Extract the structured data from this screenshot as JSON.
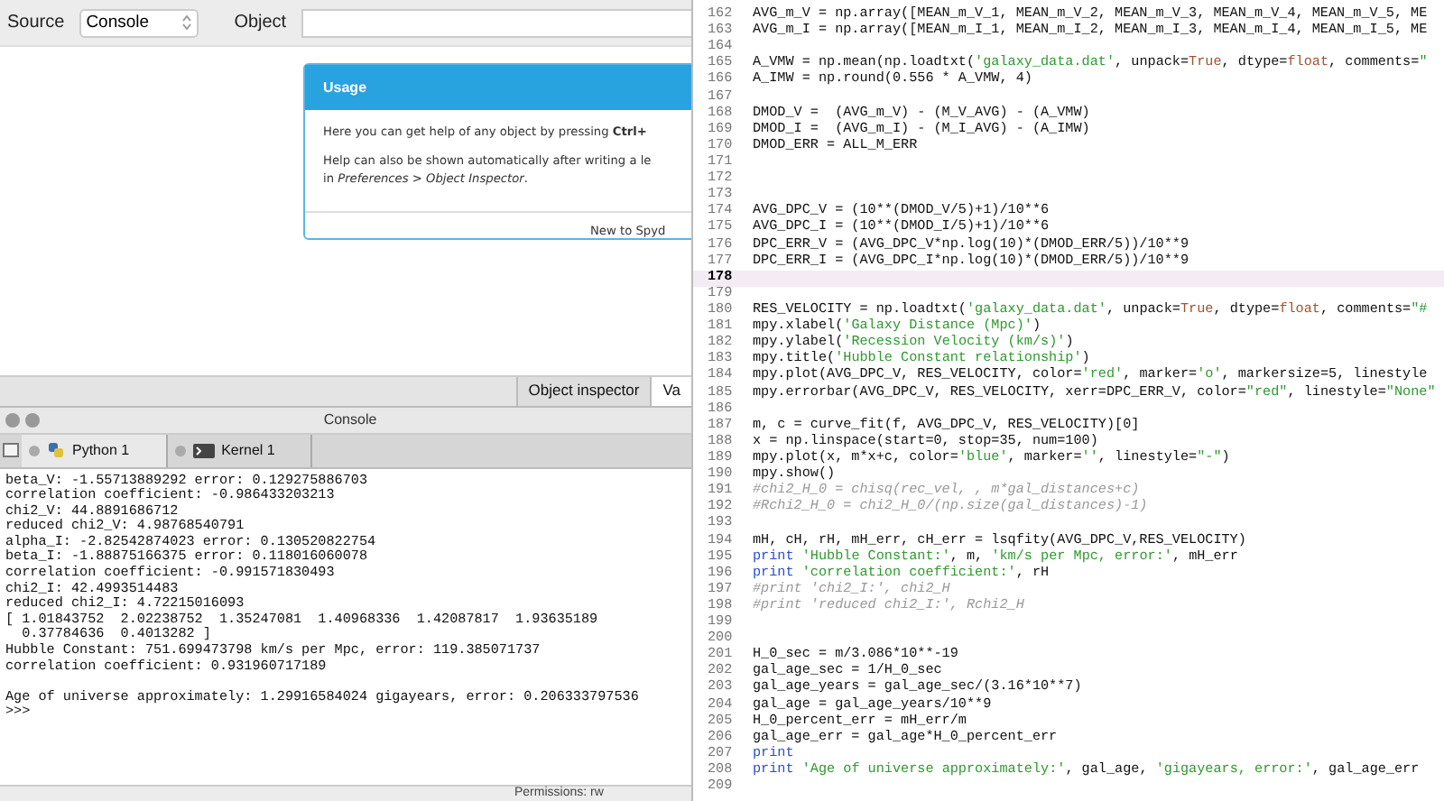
{
  "help_pane": {
    "source_label": "Source",
    "source_value": "Console",
    "object_label": "Object",
    "usage_card": {
      "title": "Usage",
      "paragraph_1": "Here you can get help of any object by pressing **Ctrl+**",
      "paragraph_2": "Help can also be shown automatically after writing a le",
      "paragraph_3": "in *Preferences > Object Inspector*.",
      "footer": "New to Spyd"
    },
    "tabs": [
      {
        "label": "Object inspector",
        "selected": true
      },
      {
        "label": "Va",
        "selected": false
      }
    ]
  },
  "console": {
    "title": "Console",
    "tabs": [
      {
        "label": "Python 1",
        "selected": true
      },
      {
        "label": "Kernel 1",
        "selected": false
      }
    ],
    "output": [
      "beta_V: -1.55713889292 error: 0.129275886703",
      "correlation coefficient: -0.986433203213",
      "chi2_V: 44.8891686712",
      "reduced chi2_V: 4.98768540791",
      "alpha_I: -2.82542874023 error: 0.130520822754",
      "beta_I: -1.88875166375 error: 0.118016060078",
      "correlation coefficient: -0.991571830493",
      "chi2_I: 42.4993514483",
      "reduced chi2_I: 4.72215016093",
      "[ 1.01843752  2.02238752  1.35247081  1.40968336  1.42087817  1.93635189",
      "  0.37784636  0.4013282 ]",
      "Hubble Constant: 751.699473798 km/s per Mpc, error: 119.385071737",
      "correlation coefficient: 0.931960717189"
    ],
    "final_output": [
      "Age of universe approximately: 1.29916584024 gigayears, error: 0.206333797536",
      ">>>"
    ],
    "status": "Permissions: rw"
  },
  "editor": {
    "lines": [
      {
        "number": "162",
        "current": false,
        "segments": [
          {
            "kind": "plain",
            "text": "AVG_m_V = np.array([MEAN_m_V_1, MEAN_m_V_2, MEAN_m_V_3, MEAN_m_V_4, MEAN_m_V_5, ME"
          }
        ]
      },
      {
        "number": "163",
        "current": false,
        "segments": [
          {
            "kind": "plain",
            "text": "AVG_m_I = np.array([MEAN_m_I_1, MEAN_m_I_2, MEAN_m_I_3, MEAN_m_I_4, MEAN_m_I_5, ME"
          }
        ]
      },
      {
        "number": "164",
        "current": false
      },
      {
        "number": "165",
        "current": false,
        "segments": [
          {
            "kind": "plain",
            "text": "A_VMW = np.mean(np.loadtxt("
          },
          {
            "kind": "str",
            "text": "'galaxy_data.dat'"
          },
          {
            "kind": "plain",
            "text": ", unpack="
          },
          {
            "kind": "kw",
            "text": "True"
          },
          {
            "kind": "plain",
            "text": ", dtype="
          },
          {
            "kind": "kw",
            "text": "float"
          },
          {
            "kind": "plain",
            "text": ", comments="
          },
          {
            "kind": "str",
            "text": "\""
          }
        ]
      },
      {
        "number": "166",
        "current": false,
        "segments": [
          {
            "kind": "plain",
            "text": "A_IMW = np.round(0.556 * A_VMW, 4)"
          }
        ]
      },
      {
        "number": "167",
        "current": false
      },
      {
        "number": "168",
        "current": false,
        "segments": [
          {
            "kind": "plain",
            "text": "DMOD_V =  (AVG_m_V) - (M_V_AVG) - (A_VMW)"
          }
        ]
      },
      {
        "number": "169",
        "current": false,
        "segments": [
          {
            "kind": "plain",
            "text": "DMOD_I =  (AVG_m_I) - (M_I_AVG) - (A_IMW)"
          }
        ]
      },
      {
        "number": "170",
        "current": false,
        "segments": [
          {
            "kind": "plain",
            "text": "DMOD_ERR = ALL_M_ERR"
          }
        ]
      },
      {
        "number": "171",
        "current": false
      },
      {
        "number": "172",
        "current": false
      },
      {
        "number": "173",
        "current": false
      },
      {
        "number": "174",
        "current": false,
        "segments": [
          {
            "kind": "plain",
            "text": "AVG_DPC_V = (10**(DMOD_V/5)+1)/10**6"
          }
        ]
      },
      {
        "number": "175",
        "current": false,
        "segments": [
          {
            "kind": "plain",
            "text": "AVG_DPC_I = (10**(DMOD_I/5)+1)/10**6"
          }
        ]
      },
      {
        "number": "176",
        "current": false,
        "segments": [
          {
            "kind": "plain",
            "text": "DPC_ERR_V = (AVG_DPC_V*np.log(10)*(DMOD_ERR/5))/10**9"
          }
        ]
      },
      {
        "number": "177",
        "current": false,
        "segments": [
          {
            "kind": "plain",
            "text": "DPC_ERR_I = (AVG_DPC_I*np.log(10)*(DMOD_ERR/5))/10**9"
          }
        ]
      },
      {
        "number": "178",
        "current": true
      },
      {
        "number": "179",
        "current": false
      },
      {
        "number": "180",
        "current": false,
        "segments": [
          {
            "kind": "plain",
            "text": "RES_VELOCITY = np.loadtxt("
          },
          {
            "kind": "str",
            "text": "'galaxy_data.dat'"
          },
          {
            "kind": "plain",
            "text": ", unpack="
          },
          {
            "kind": "kw",
            "text": "True"
          },
          {
            "kind": "plain",
            "text": ", dtype="
          },
          {
            "kind": "kw",
            "text": "float"
          },
          {
            "kind": "plain",
            "text": ", comments="
          },
          {
            "kind": "str",
            "text": "\"#"
          }
        ]
      },
      {
        "number": "181",
        "current": false,
        "segments": [
          {
            "kind": "plain",
            "text": "mpy.xlabel("
          },
          {
            "kind": "str",
            "text": "'Galaxy Distance (Mpc)'"
          },
          {
            "kind": "plain",
            "text": ")"
          }
        ]
      },
      {
        "number": "182",
        "current": false,
        "segments": [
          {
            "kind": "plain",
            "text": "mpy.ylabel("
          },
          {
            "kind": "str",
            "text": "'Recession Velocity (km/s)'"
          },
          {
            "kind": "plain",
            "text": ")"
          }
        ]
      },
      {
        "number": "183",
        "current": false,
        "segments": [
          {
            "kind": "plain",
            "text": "mpy.title("
          },
          {
            "kind": "str",
            "text": "'Hubble Constant relationship'"
          },
          {
            "kind": "plain",
            "text": ")"
          }
        ]
      },
      {
        "number": "184",
        "current": false,
        "segments": [
          {
            "kind": "plain",
            "text": "mpy.plot(AVG_DPC_V, RES_VELOCITY, color="
          },
          {
            "kind": "str",
            "text": "'red'"
          },
          {
            "kind": "plain",
            "text": ", marker="
          },
          {
            "kind": "str",
            "text": "'o'"
          },
          {
            "kind": "plain",
            "text": ", markersize=5, linestyle"
          }
        ]
      },
      {
        "number": "185",
        "current": false,
        "segments": [
          {
            "kind": "plain",
            "text": "mpy.errorbar(AVG_DPC_V, RES_VELOCITY, xerr=DPC_ERR_V, color="
          },
          {
            "kind": "str",
            "text": "\"red\""
          },
          {
            "kind": "plain",
            "text": ", linestyle="
          },
          {
            "kind": "str",
            "text": "\"None\""
          }
        ]
      },
      {
        "number": "186",
        "current": false
      },
      {
        "number": "187",
        "current": false,
        "segments": [
          {
            "kind": "plain",
            "text": "m, c = curve_fit(f, AVG_DPC_V, RES_VELOCITY)[0]"
          }
        ]
      },
      {
        "number": "188",
        "current": false,
        "segments": [
          {
            "kind": "plain",
            "text": "x = np.linspace(start=0, stop=35, num=100)"
          }
        ]
      },
      {
        "number": "189",
        "current": false,
        "segments": [
          {
            "kind": "plain",
            "text": "mpy.plot(x, m*x+c, color="
          },
          {
            "kind": "str",
            "text": "'blue'"
          },
          {
            "kind": "plain",
            "text": ", marker="
          },
          {
            "kind": "str",
            "text": "''"
          },
          {
            "kind": "plain",
            "text": ", linestyle="
          },
          {
            "kind": "str",
            "text": "\"-\""
          },
          {
            "kind": "plain",
            "text": ")"
          }
        ]
      },
      {
        "number": "190",
        "current": false,
        "segments": [
          {
            "kind": "plain",
            "text": "mpy.show()"
          }
        ]
      },
      {
        "number": "191",
        "current": false,
        "segments": [
          {
            "kind": "comment",
            "text": "#chi2_H_0 = chisq(rec_vel, , m*gal_distances+c)"
          }
        ]
      },
      {
        "number": "192",
        "current": false,
        "segments": [
          {
            "kind": "comment",
            "text": "#Rchi2_H_0 = chi2_H_0/(np.size(gal_distances)-1)"
          }
        ]
      },
      {
        "number": "193",
        "current": false
      },
      {
        "number": "194",
        "current": false,
        "segments": [
          {
            "kind": "plain",
            "text": "mH, cH, rH, mH_err, cH_err = lsqfity(AVG_DPC_V,RES_VELOCITY)"
          }
        ]
      },
      {
        "number": "195",
        "current": false,
        "segments": [
          {
            "kind": "kw2",
            "text": "print"
          },
          {
            "kind": "str",
            "text": " 'Hubble Constant:'"
          },
          {
            "kind": "plain",
            "text": ", m, "
          },
          {
            "kind": "str",
            "text": "'km/s per Mpc, error:'"
          },
          {
            "kind": "plain",
            "text": ", mH_err"
          }
        ]
      },
      {
        "number": "196",
        "current": false,
        "segments": [
          {
            "kind": "kw2",
            "text": "print"
          },
          {
            "kind": "str",
            "text": " 'correlation coefficient:'"
          },
          {
            "kind": "plain",
            "text": ", rH"
          }
        ]
      },
      {
        "number": "197",
        "current": false,
        "segments": [
          {
            "kind": "comment",
            "text": "#print 'chi2_I:', chi2_H"
          }
        ]
      },
      {
        "number": "198",
        "current": false,
        "segments": [
          {
            "kind": "comment",
            "text": "#print 'reduced chi2_I:', Rchi2_H"
          }
        ]
      },
      {
        "number": "199",
        "current": false
      },
      {
        "number": "200",
        "current": false
      },
      {
        "number": "201",
        "current": false,
        "segments": [
          {
            "kind": "plain",
            "text": "H_0_sec = m/3.086*10**-19"
          }
        ]
      },
      {
        "number": "202",
        "current": false,
        "segments": [
          {
            "kind": "plain",
            "text": "gal_age_sec = 1/H_0_sec"
          }
        ]
      },
      {
        "number": "203",
        "current": false,
        "segments": [
          {
            "kind": "plain",
            "text": "gal_age_years = gal_age_sec/(3.16*10**7)"
          }
        ]
      },
      {
        "number": "204",
        "current": false,
        "segments": [
          {
            "kind": "plain",
            "text": "gal_age = gal_age_years/10**9"
          }
        ]
      },
      {
        "number": "205",
        "current": false,
        "segments": [
          {
            "kind": "plain",
            "text": "H_0_percent_err = mH_err/m"
          }
        ]
      },
      {
        "number": "206",
        "current": false,
        "segments": [
          {
            "kind": "plain",
            "text": "gal_age_err = gal_age*H_0_percent_err"
          }
        ]
      },
      {
        "number": "207",
        "current": false,
        "segments": [
          {
            "kind": "kw2",
            "text": "print"
          }
        ]
      },
      {
        "number": "208",
        "current": false,
        "segments": [
          {
            "kind": "kw2",
            "text": "print"
          },
          {
            "kind": "str",
            "text": " 'Age of universe approximately:'"
          },
          {
            "kind": "plain",
            "text": ", gal_age, "
          },
          {
            "kind": "str",
            "text": "'gigayears, error:'"
          },
          {
            "kind": "plain",
            "text": ", gal_age_err"
          }
        ]
      },
      {
        "number": "209",
        "current": false
      }
    ]
  }
}
